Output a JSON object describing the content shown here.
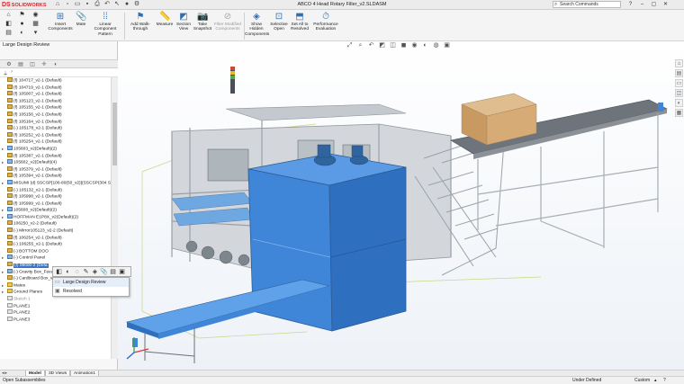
{
  "app": {
    "logo_mark": "DS",
    "logo_text": "SOLIDWORKS",
    "document_title": "ABCO 4 Head Rotary Filler_v2.SLDASM",
    "search_placeholder": "Search Commands"
  },
  "quick_access": [
    "home-icon",
    "new-document-icon",
    "open-icon",
    "save-icon",
    "print-icon",
    "undo-icon",
    "select-icon",
    "rebuild-icon",
    "options-icon"
  ],
  "commands": [
    {
      "label": "Insert Components",
      "icon": "insert-components-icon",
      "enabled": true
    },
    {
      "label": "Mate",
      "icon": "mate-icon",
      "enabled": true
    },
    {
      "label": "Linear Component Pattern",
      "icon": "linear-pattern-icon",
      "enabled": true
    },
    {
      "label": "Add Walk-through",
      "icon": "walk-through-icon",
      "enabled": true
    },
    {
      "label": "Measure",
      "icon": "measure-icon",
      "enabled": true
    },
    {
      "label": "Section View",
      "icon": "section-view-icon",
      "enabled": true
    },
    {
      "label": "Take Snapshot",
      "icon": "snapshot-icon",
      "enabled": true
    },
    {
      "label": "Filter Modified Components",
      "icon": "filter-modified-icon",
      "enabled": false
    },
    {
      "label": "Show Hidden Components",
      "icon": "show-hidden-icon",
      "enabled": true
    },
    {
      "label": "Selective Open",
      "icon": "selective-open-icon",
      "enabled": true
    },
    {
      "label": "Set All to Resolved",
      "icon": "set-resolved-icon",
      "enabled": true
    },
    {
      "label": "Performance Evaluation",
      "icon": "performance-icon",
      "enabled": true
    }
  ],
  "panel": {
    "title": "Large Design Review",
    "tree": [
      {
        "label": "(f) 104717_v2-1 (Default)",
        "kind": "part"
      },
      {
        "label": "(f) 104719_v2-1 (Default)",
        "kind": "part"
      },
      {
        "label": "(f) 105007_v2-1 (Default)",
        "kind": "part"
      },
      {
        "label": "(f) 105123_v2-1 (Default)",
        "kind": "part"
      },
      {
        "label": "(f) 105155_v2-1 (Default)",
        "kind": "part"
      },
      {
        "label": "(f) 105156_v2-1 (Default)",
        "kind": "part"
      },
      {
        "label": "(f) 105164_v2-1 (Default)",
        "kind": "part"
      },
      {
        "label": "(-) 105178_v2-1 (Default)",
        "kind": "part"
      },
      {
        "label": "(f) 105252_v2-1 (Default)",
        "kind": "part"
      },
      {
        "label": "(f) 105254_v2-1 (Default)",
        "kind": "part"
      },
      {
        "label": "105603_v2(Default)(2)",
        "kind": "sub"
      },
      {
        "label": "(f) 105387_v2-1 (Default)",
        "kind": "part"
      },
      {
        "label": "105602_v2(Default)(4)",
        "kind": "sub"
      },
      {
        "label": "(f) 105379_v2-1 (Default)",
        "kind": "part"
      },
      {
        "label": "(f) 105394_v2-1 (Default)",
        "kind": "part"
      },
      {
        "label": "MISUMI (d) SSCSP[100-80(50_v2)](SSCSP(304 Stair",
        "kind": "sub"
      },
      {
        "label": "(-) 105132_v2-1 (Default)",
        "kind": "part"
      },
      {
        "label": "(f) 105998_v2-1 (Default)",
        "kind": "part"
      },
      {
        "label": "(f) 105999_v2-1 (Default)",
        "kind": "part"
      },
      {
        "label": "105608_v2(Default)(2)",
        "kind": "sub"
      },
      {
        "label": "HOFFMAN E1P8X_v2(Default)(2)",
        "kind": "sub"
      },
      {
        "label": "106250_v2-2 (Default)",
        "kind": "part"
      },
      {
        "label": "(-) Mirror105123_v2-2 (Default)",
        "kind": "part"
      },
      {
        "label": "(f) 106254_v2-1 (Default)",
        "kind": "part"
      },
      {
        "label": "(-) 106255_v2-1 (Default)",
        "kind": "part"
      },
      {
        "label": "(-) BOTTOM DOO",
        "kind": "part"
      },
      {
        "label": "(-) Control Panel",
        "kind": "sub"
      },
      {
        "label": "(f) 09000-2 (Defa",
        "kind": "part",
        "selected": true
      },
      {
        "label": "(-) Gravity Box_Feed_v2-1 (Default)",
        "kind": "sub"
      },
      {
        "label": "(-) Cardboard Box_v2-1 (Default)",
        "kind": "part"
      },
      {
        "label": "Mates",
        "kind": "folder"
      },
      {
        "label": "Ground Planes",
        "kind": "folder"
      },
      {
        "label": "Sketch 1",
        "kind": "plane",
        "muted": true
      },
      {
        "label": "PLANE1",
        "kind": "plane"
      },
      {
        "label": "PLANE2",
        "kind": "plane"
      },
      {
        "label": "PLANE3",
        "kind": "plane"
      }
    ]
  },
  "context_menu": {
    "items": [
      {
        "label": "Large Design Review",
        "highlighted": true
      },
      {
        "label": "Resolved",
        "highlighted": false
      }
    ]
  },
  "bottom_tabs": [
    {
      "label": "Model",
      "active": true
    },
    {
      "label": "3D Views",
      "active": false
    },
    {
      "label": "Animation1",
      "active": false
    }
  ],
  "status": {
    "left": "Open Subassemblies",
    "under_defined": "Under Defined",
    "units": "Custom"
  },
  "colors": {
    "accent": "#2c6fb7",
    "selection": "#3874c8",
    "enclosure_blue": "#3f86d8",
    "brand_red": "#d7262e",
    "cardboard": "#d2a774"
  }
}
